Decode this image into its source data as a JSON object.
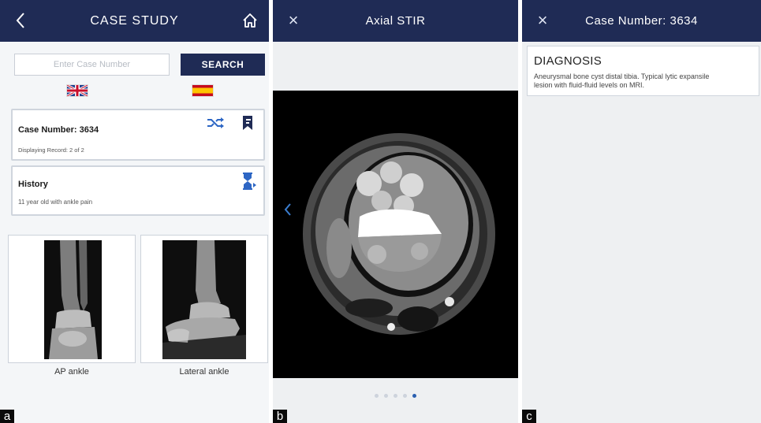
{
  "panel_a": {
    "title": "CASE STUDY",
    "back_icon": "chevron-left-icon",
    "home_icon": "home-icon",
    "search": {
      "placeholder": "Enter Case Number",
      "value": "",
      "button_label": "SEARCH"
    },
    "languages": [
      {
        "name": "english-flag",
        "icon": "uk-flag-icon"
      },
      {
        "name": "spanish-flag",
        "icon": "spain-flag-icon"
      }
    ],
    "case_card": {
      "title": "Case Number: 3634",
      "subtitle": "Displaying Record: 2 of 2",
      "icons": [
        "shuffle-icon",
        "bookmark-icon"
      ]
    },
    "history_card": {
      "title": "History",
      "text": "11 year old with ankle pain",
      "icon": "timer-icon"
    },
    "images": [
      {
        "label": "AP ankle"
      },
      {
        "label": "Lateral ankle"
      }
    ],
    "panel_letter": "a"
  },
  "panel_b": {
    "title": "Axial STIR",
    "close_icon": "close-icon",
    "prev_icon": "chevron-left-icon",
    "pager": {
      "count": 5,
      "active": 5
    },
    "panel_letter": "b"
  },
  "panel_c": {
    "title": "Case Number: 3634",
    "close_icon": "close-icon",
    "diagnosis": {
      "heading": "DIAGNOSIS",
      "text": "Aneurysmal bone cyst distal tibia. Typical lytic expansile lesion with fluid-fluid levels on MRI."
    },
    "panel_letter": "c"
  },
  "colors": {
    "navbar": "#1f2b55",
    "accent_icon": "#2d66c4",
    "background": "#f4f6f8"
  }
}
